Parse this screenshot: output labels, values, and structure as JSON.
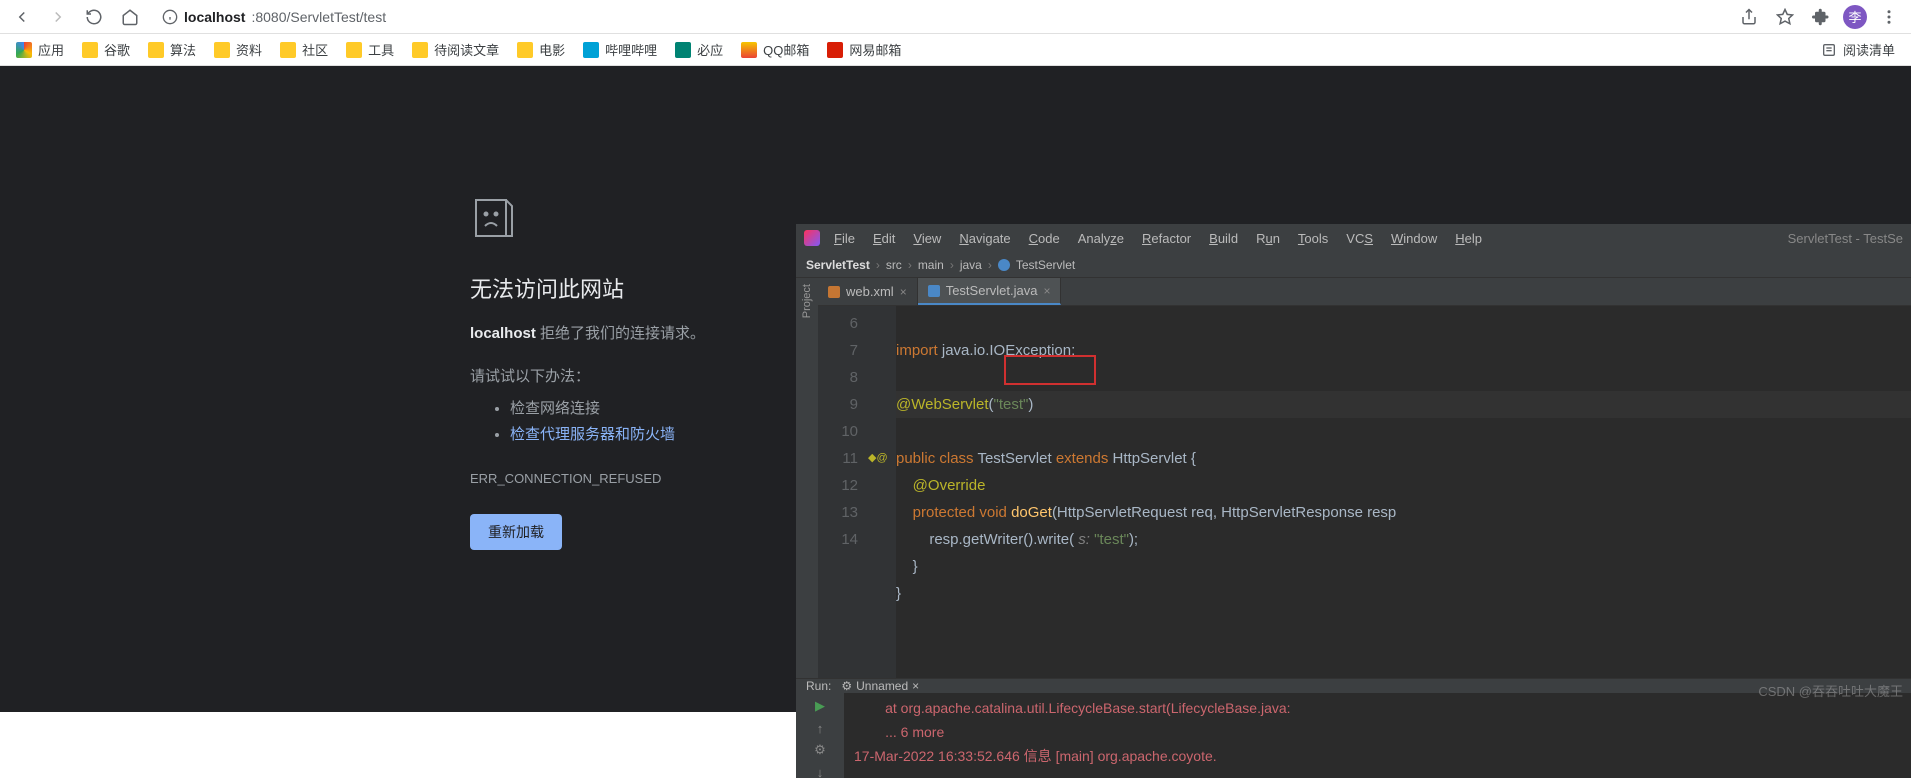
{
  "browser": {
    "url_host": "localhost",
    "url_rest": ":8080/ServletTest/test",
    "avatar_initial": "李"
  },
  "bookmarks": {
    "apps": "应用",
    "items": [
      "谷歌",
      "算法",
      "资料",
      "社区",
      "工具",
      "待阅读文章",
      "电影",
      "哔哩哔哩",
      "必应",
      "QQ邮箱",
      "网易邮箱"
    ],
    "reading_list": "阅读清单"
  },
  "error": {
    "title": "无法访问此网站",
    "host": "localhost",
    "sub_rest": " 拒绝了我们的连接请求。",
    "try": "请试试以下办法：",
    "item1": "检查网络连接",
    "item2": "检查代理服务器和防火墙",
    "code": "ERR_CONNECTION_REFUSED",
    "reload": "重新加载"
  },
  "ide": {
    "menu": [
      "File",
      "Edit",
      "View",
      "Navigate",
      "Code",
      "Analyze",
      "Refactor",
      "Build",
      "Run",
      "Tools",
      "VCS",
      "Window",
      "Help"
    ],
    "project_title": "ServletTest - TestSe",
    "crumbs": [
      "ServletTest",
      "src",
      "main",
      "java",
      "TestServlet"
    ],
    "tabs": [
      {
        "name": "web.xml",
        "active": false
      },
      {
        "name": "TestServlet.java",
        "active": true
      }
    ],
    "line_numbers": [
      "6",
      "7",
      "8",
      "9",
      "10",
      "11",
      "12",
      "13",
      "14"
    ],
    "code": {
      "l6_import": "import",
      "l6_rest": " java.io.IOException;",
      "l8_ann": "@WebServlet",
      "l8_open": "(",
      "l8_q1": "\"",
      "l8_str": "test",
      "l8_q2": "\"",
      "l8_close": ")",
      "l9_public": "public class",
      "l9_name": " TestServlet ",
      "l9_ext": "extends",
      "l9_http": " HttpServlet {",
      "l10": "    @Override",
      "l11_prot": "    protected void",
      "l11_method": " doGet",
      "l11_rest": "(HttpServletRequest req, HttpServletResponse resp",
      "l12_a": "        resp.getWriter().write(",
      "l12_p": " s: ",
      "l12_s": "\"test\"",
      "l12_e": ");",
      "l13": "    }",
      "l14": "}"
    },
    "run": {
      "label": "Run:",
      "tab": "Unnamed",
      "line1": "        at org.apache.catalina.util.LifecycleBase.start(LifecycleBase.java:",
      "line2": "        ... 6 more",
      "line3": "17-Mar-2022 16:33:52.646 信息 [main] org.apache.coyote."
    }
  },
  "watermark": "CSDN @吞吞吐吐大魔王"
}
